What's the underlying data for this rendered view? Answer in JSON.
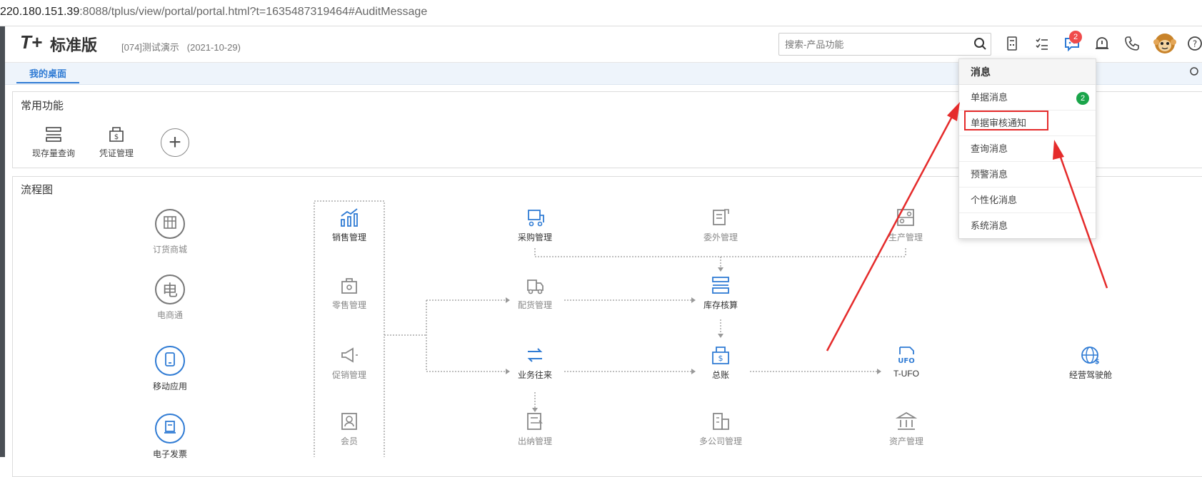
{
  "address": {
    "host": "220.180.151.39",
    "rest": ":8088/tplus/view/portal/portal.html?t=1635487319464#AuditMessage"
  },
  "header": {
    "logo": "T+",
    "edition": "标准版",
    "company": "[074]测试演示",
    "date": "(2021-10-29)",
    "search_placeholder": "搜索-产品功能",
    "message_badge": "2"
  },
  "tabs": [
    "我的桌面"
  ],
  "favorites": {
    "title": "常用功能",
    "items": [
      "现存量查询",
      "凭证管理"
    ]
  },
  "flow": {
    "title": "流程图",
    "left_nodes": [
      "订货商城",
      "电商通",
      "移动应用",
      "电子发票"
    ],
    "column_nodes": [
      "销售管理",
      "零售管理",
      "促销管理",
      "会员"
    ],
    "nodes": {
      "purchase": "采购管理",
      "outsource": "委外管理",
      "production": "生产管理",
      "distribution": "配货管理",
      "inventory": "库存核算",
      "business": "业务往来",
      "ledger": "总账",
      "tufo": "T-UFO",
      "cockpit": "经营驾驶舱",
      "cashier": "出纳管理",
      "multi_company": "多公司管理",
      "assets": "资产管理"
    }
  },
  "messages": {
    "title": "消息",
    "items": [
      "单据消息",
      "单据审核通知",
      "查询消息",
      "预警消息",
      "个性化消息",
      "系统消息"
    ],
    "first_badge": "2"
  },
  "colors": {
    "accent": "#2f7bd4",
    "highlight": "#e52b2b",
    "badge_red": "#f04b4b",
    "badge_green": "#1aa54a"
  }
}
